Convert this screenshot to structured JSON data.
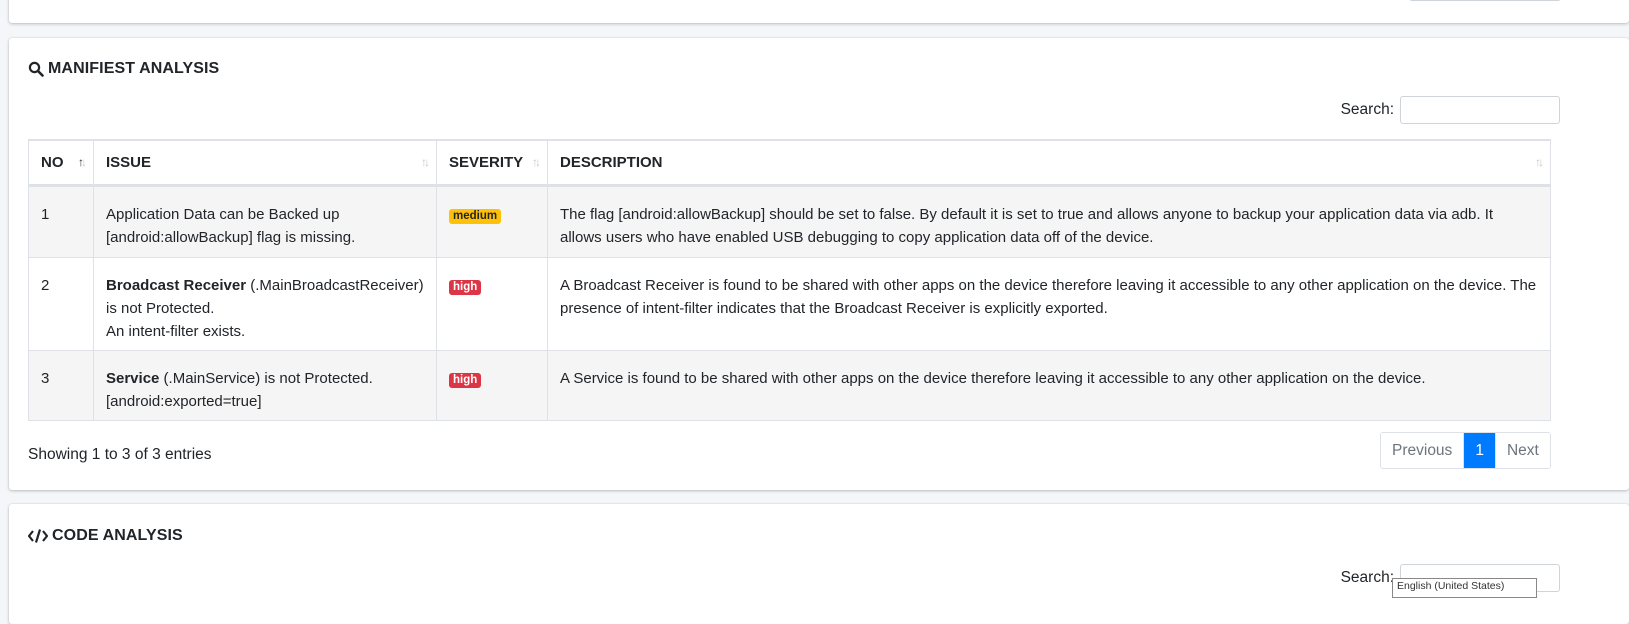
{
  "manifest": {
    "title": "MANIFIEST ANALYSIS",
    "search_label": "Search:",
    "search_value": "",
    "columns": [
      "NO",
      "ISSUE",
      "SEVERITY",
      "DESCRIPTION"
    ],
    "rows": [
      {
        "no": "1",
        "issue_bold": "",
        "issue_lines": [
          "Application Data can be Backed up",
          "[android:allowBackup] flag is missing."
        ],
        "severity": "medium",
        "description": "The flag [android:allowBackup] should be set to false. By default it is set to true and allows anyone to backup your application data via adb. It allows users who have enabled USB debugging to copy application data off of the device."
      },
      {
        "no": "2",
        "issue_bold": "Broadcast Receiver",
        "issue_lines": [
          " (.MainBroadcastReceiver)",
          "is not Protected.",
          "An intent-filter exists."
        ],
        "severity": "high",
        "description": "A Broadcast Receiver is found to be shared with other apps on the device therefore leaving it accessible to any other application on the device. The presence of intent-filter indicates that the Broadcast Receiver is explicitly exported."
      },
      {
        "no": "3",
        "issue_bold": "Service",
        "issue_lines": [
          " (.MainService) is not Protected.",
          "[android:exported=true]"
        ],
        "severity": "high",
        "description": "A Service is found to be shared with other apps on the device therefore leaving it accessible to any other application on the device."
      }
    ],
    "info": "Showing 1 to 3 of 3 entries",
    "pagination": {
      "previous": "Previous",
      "current": "1",
      "next": "Next"
    }
  },
  "code": {
    "title": "CODE ANALYSIS",
    "search_label": "Search:",
    "lang_popup": "English (United States)"
  },
  "colors": {
    "medium": "#ffc107",
    "high": "#dc3545",
    "primary": "#007bff"
  },
  "icons": {
    "manifest": "search-icon",
    "code": "code-icon"
  }
}
